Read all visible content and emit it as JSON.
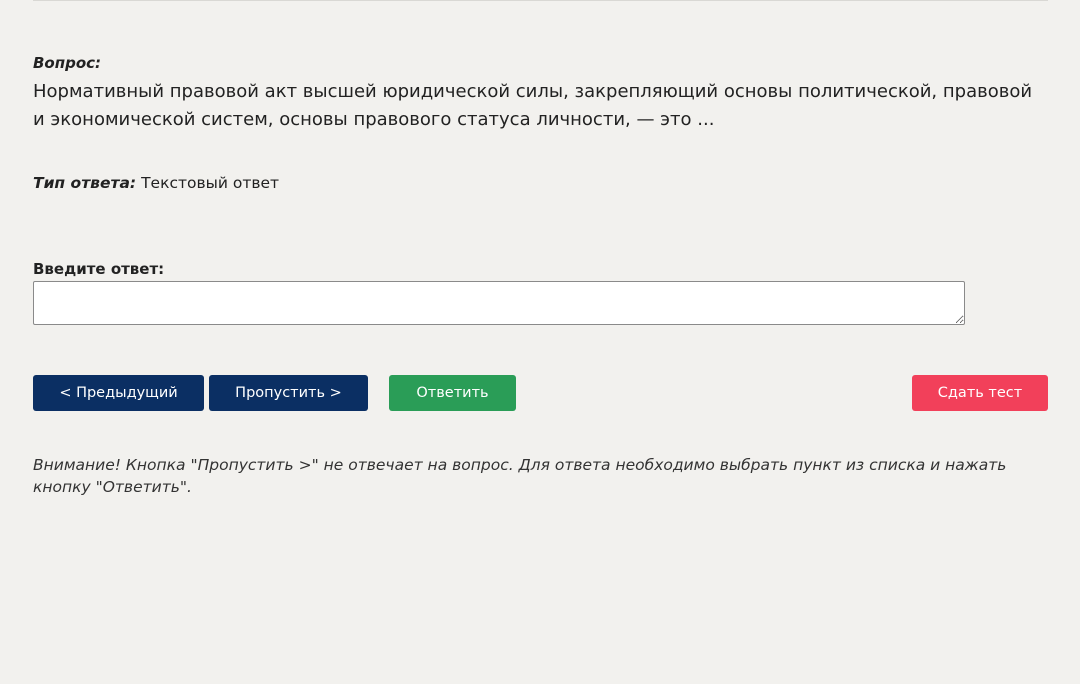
{
  "question": {
    "label": "Вопрос:",
    "text": "Нормативный правовой акт высшей юридической силы, закрепляющий основы политической, правовой и экономической систем, основы правового статуса личности, — это ..."
  },
  "answer_type": {
    "label": "Тип ответа:",
    "value": "Текстовый ответ"
  },
  "answer_input": {
    "label": "Введите ответ:",
    "value": "",
    "placeholder": ""
  },
  "buttons": {
    "prev": "< Предыдущий",
    "skip": "Пропустить >",
    "answer": "Ответить",
    "submit": "Сдать тест"
  },
  "warning": "Внимание! Кнопка \"Пропустить >\" не отвечает на вопрос. Для ответа необходимо выбрать пункт из списка и нажать кнопку \"Ответить\".",
  "colors": {
    "page_background": "#f2f1ee",
    "nav_button": "#0b2f63",
    "answer_button": "#2a9d57",
    "submit_button": "#f2405a"
  }
}
